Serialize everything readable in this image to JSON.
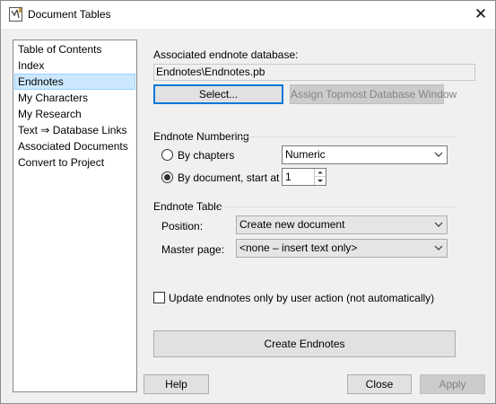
{
  "window": {
    "title": "Document Tables",
    "close_glyph": "✕",
    "app_icon": "app-icon"
  },
  "nav": {
    "items": [
      {
        "label": "Table of Contents",
        "selected": false
      },
      {
        "label": "Index",
        "selected": false
      },
      {
        "label": "Endnotes",
        "selected": true
      },
      {
        "label": "My Characters",
        "selected": false
      },
      {
        "label": "My Research",
        "selected": false
      },
      {
        "label": "Text ⇒ Database Links",
        "selected": false
      },
      {
        "label": "Associated Documents",
        "selected": false
      },
      {
        "label": "Convert to Project",
        "selected": false
      }
    ]
  },
  "database": {
    "label": "Associated endnote database:",
    "value": "Endnotes\\Endnotes.pb",
    "select_button": "Select...",
    "topmost_button": "Assign Topmost Database Window"
  },
  "numbering": {
    "group_label": "Endnote Numbering",
    "by_chapters_label": "By chapters",
    "by_chapters_checked": false,
    "numbering_style": "Numeric",
    "by_document_label": "By document, start at",
    "by_document_checked": true,
    "start_value": "1"
  },
  "endnote_table": {
    "group_label": "Endnote Table",
    "position_label": "Position:",
    "position_value": "Create new document",
    "master_label": "Master page:",
    "master_value": "<none – insert text only>"
  },
  "update_option": {
    "label": "Update endnotes only by user action (not automatically)",
    "checked": false
  },
  "buttons": {
    "create": "Create Endnotes",
    "help": "Help",
    "close": "Close",
    "apply": "Apply"
  },
  "colors": {
    "selection": "#cce8ff",
    "focus_border": "#0078d7",
    "window_bg": "#f0f0f0"
  }
}
